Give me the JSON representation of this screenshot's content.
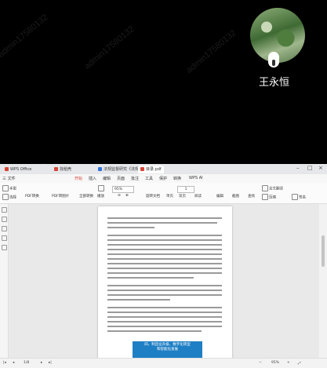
{
  "call": {
    "user_name": "王永恒"
  },
  "watermark": {
    "text": "admin17580132"
  },
  "tabs": [
    {
      "label": "WPS Office",
      "color": "#d64534"
    },
    {
      "label": "找稻壳",
      "color": "#d64534"
    },
    {
      "label": "法规监督研究《法规》",
      "color": "#2f73d9"
    },
    {
      "label": "目录.pdf",
      "color": "#d64534"
    }
  ],
  "menu": {
    "file": "三 文件",
    "items": [
      "开始",
      "插入",
      "编辑",
      "页面",
      "批注",
      "工具",
      "保护",
      "转换",
      "WPS AI"
    ],
    "active": "开始"
  },
  "ribbon": {
    "hand": "手型",
    "select": "选择",
    "pdf_convert": "PDF转换",
    "pdf_to_image": "PDF转图片",
    "all_convert": "全部转换",
    "play": "播放",
    "zoom": "95%",
    "page_number": "1",
    "rotate": "旋转文档",
    "single_page": "单页",
    "double_page": "双页",
    "read": "阅读",
    "edit_content": "编辑",
    "screenshot": "截图",
    "find": "查找",
    "full_translate": "全文翻译",
    "compress": "压缩",
    "sign": "签名"
  },
  "document": {
    "box_line1": "四、制造业升级、数字化转型",
    "box_line2": "和智能化发展"
  },
  "status": {
    "page": "1/8",
    "zoom": "95%"
  }
}
